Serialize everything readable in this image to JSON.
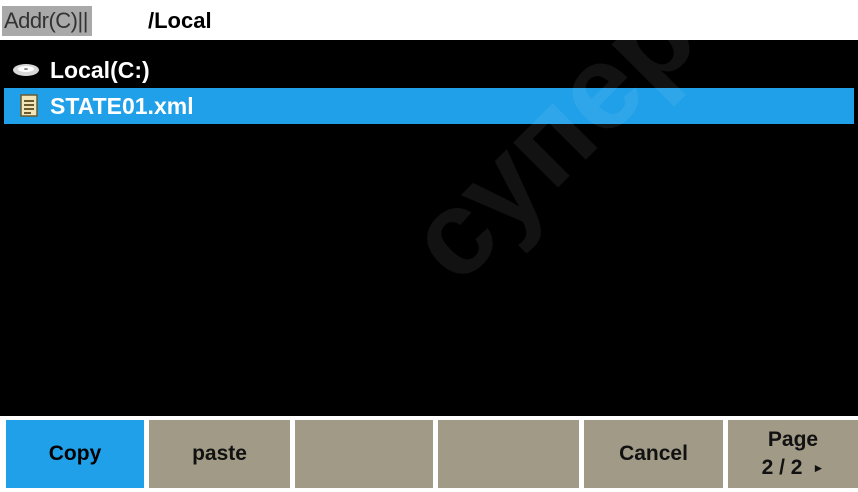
{
  "address": {
    "label": "Addr(C)||",
    "path": "/Local"
  },
  "browser": {
    "drive": {
      "label": "Local(C:)",
      "icon": "disk-icon"
    },
    "files": [
      {
        "label": "STATE01.xml",
        "icon": "file-icon",
        "selected": true
      }
    ]
  },
  "softkeys": {
    "copy": "Copy",
    "paste": "paste",
    "blank1": "",
    "blank2": "",
    "cancel": "Cancel",
    "page_label": "Page",
    "page_value": "2 / 2"
  },
  "watermark": "супер",
  "colors": {
    "selection": "#20a0e8",
    "softkey": "#a19a87",
    "background": "#000000"
  }
}
